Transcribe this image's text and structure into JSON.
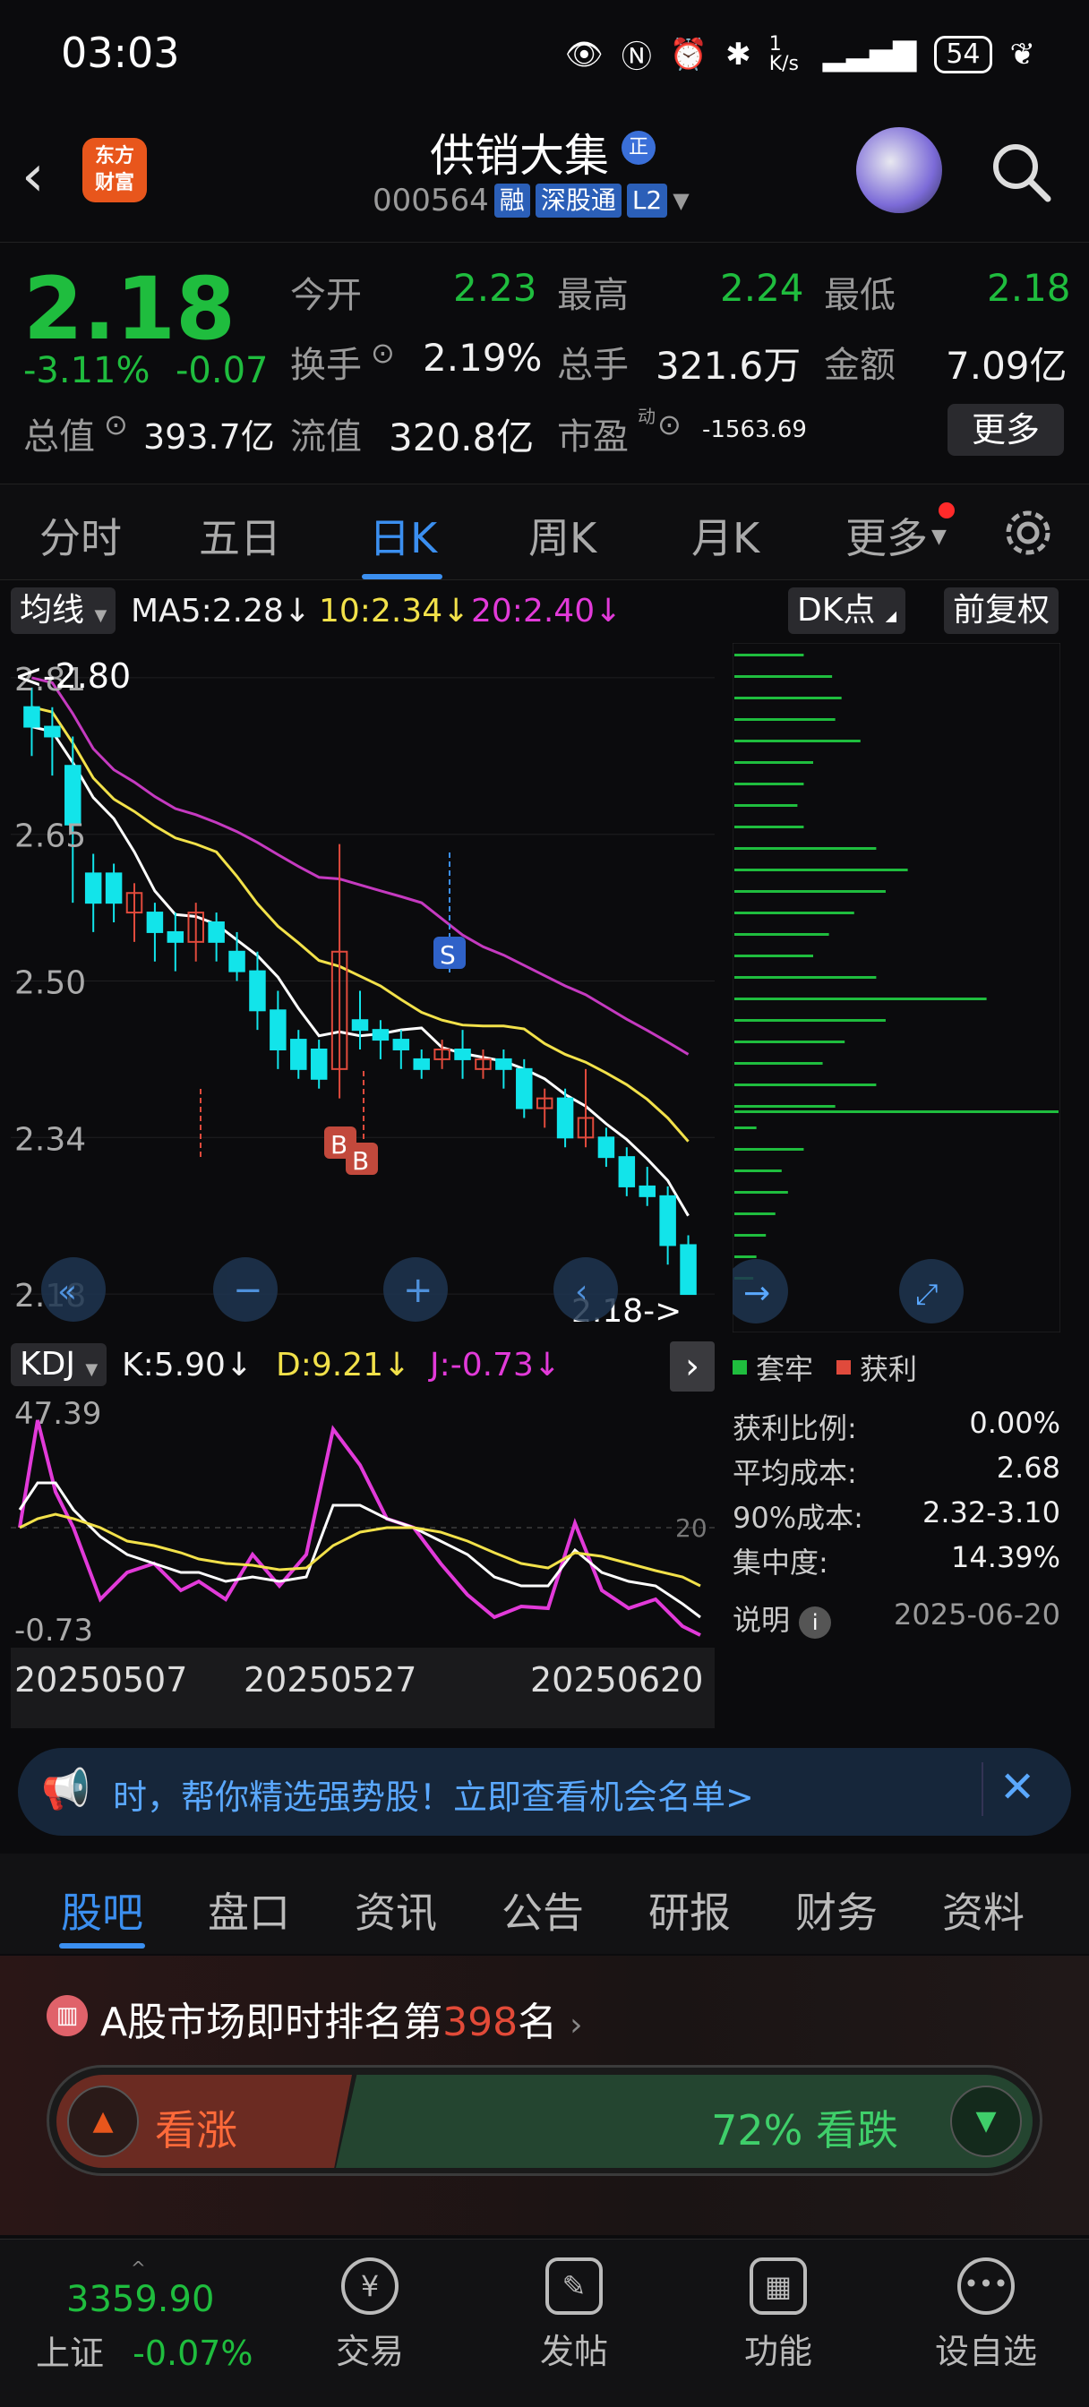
{
  "status_bar": {
    "time": "03:03",
    "speed": "1 K/s",
    "battery": "54"
  },
  "header": {
    "logo_line1": "东方",
    "logo_line2": "财富",
    "stock_name": "供销大集",
    "name_badge": "正",
    "code": "000564",
    "tags": [
      "融",
      "深股通",
      "L2"
    ]
  },
  "quote": {
    "price": "2.18",
    "change_pct": "-3.11%",
    "change": "-0.07",
    "open_label": "今开",
    "open": "2.23",
    "high_label": "最高",
    "high": "2.24",
    "low_label": "最低",
    "low": "2.18",
    "turnover_label": "换手",
    "turnover": "2.19%",
    "volume_label": "总手",
    "volume": "321.6万",
    "amount_label": "金额",
    "amount": "7.09亿",
    "mktcap_label": "总值",
    "mktcap": "393.7亿",
    "float_label": "流值",
    "float": "320.8亿",
    "pe_label": "市盈",
    "pe_sup": "动",
    "pe": "-1563.69",
    "more": "更多"
  },
  "tabs": [
    "分时",
    "五日",
    "日K",
    "周K",
    "月K",
    "更多"
  ],
  "ma_bar": {
    "selector": "均线",
    "ma5": "MA5:2.28↓",
    "ma10": "10:2.34↓",
    "ma20": "20:2.40↓",
    "dk": "DK点",
    "adjust": "前复权"
  },
  "chart_data": {
    "type": "candlestick",
    "y_ticks": [
      "2.81",
      "2.65",
      "2.50",
      "2.34",
      "2.18"
    ],
    "max_label": "<-2.80",
    "last_label": "2.18->",
    "markers": [
      "B",
      "B",
      "S"
    ],
    "candles": [
      [
        2.78,
        2.76,
        2.8,
        2.73
      ],
      [
        2.76,
        2.75,
        2.78,
        2.71
      ],
      [
        2.72,
        2.66,
        2.75,
        2.58
      ],
      [
        2.61,
        2.58,
        2.63,
        2.55
      ],
      [
        2.61,
        2.58,
        2.62,
        2.56
      ],
      [
        2.57,
        2.59,
        2.6,
        2.54
      ],
      [
        2.57,
        2.55,
        2.58,
        2.52
      ],
      [
        2.55,
        2.54,
        2.57,
        2.51
      ],
      [
        2.54,
        2.57,
        2.58,
        2.52
      ],
      [
        2.56,
        2.54,
        2.57,
        2.52
      ],
      [
        2.53,
        2.51,
        2.55,
        2.5
      ],
      [
        2.51,
        2.47,
        2.53,
        2.45
      ],
      [
        2.47,
        2.43,
        2.49,
        2.41
      ],
      [
        2.44,
        2.41,
        2.45,
        2.4
      ],
      [
        2.43,
        2.4,
        2.44,
        2.39
      ],
      [
        2.41,
        2.53,
        2.64,
        2.38
      ],
      [
        2.46,
        2.45,
        2.49,
        2.43
      ],
      [
        2.45,
        2.44,
        2.46,
        2.42
      ],
      [
        2.44,
        2.43,
        2.45,
        2.41
      ],
      [
        2.42,
        2.41,
        2.43,
        2.4
      ],
      [
        2.42,
        2.43,
        2.44,
        2.41
      ],
      [
        2.43,
        2.42,
        2.45,
        2.4
      ],
      [
        2.41,
        2.42,
        2.43,
        2.4
      ],
      [
        2.42,
        2.41,
        2.43,
        2.39
      ],
      [
        2.41,
        2.37,
        2.42,
        2.36
      ],
      [
        2.37,
        2.38,
        2.39,
        2.35
      ],
      [
        2.38,
        2.34,
        2.39,
        2.33
      ],
      [
        2.34,
        2.36,
        2.41,
        2.33
      ],
      [
        2.34,
        2.32,
        2.35,
        2.31
      ],
      [
        2.32,
        2.29,
        2.33,
        2.28
      ],
      [
        2.29,
        2.28,
        2.31,
        2.27
      ],
      [
        2.28,
        2.23,
        2.29,
        2.21
      ],
      [
        2.23,
        2.18,
        2.24,
        2.18
      ]
    ],
    "chip_bars": [
      0.22,
      0.31,
      0.34,
      0.32,
      0.4,
      0.25,
      0.22,
      0.2,
      0.22,
      0.45,
      0.55,
      0.48,
      0.38,
      0.3,
      0.25,
      0.45,
      0.8,
      0.48,
      0.35,
      0.28,
      0.45,
      0.32,
      0.07,
      0.22,
      0.15,
      0.17,
      0.13,
      0.1,
      0.07,
      0.06
    ],
    "chip_peak_index": 20
  },
  "kdj": {
    "selector": "KDJ",
    "k": "K:5.90↓",
    "d": "D:9.21↓",
    "j": "J:-0.73↓",
    "y_top": "47.39",
    "y_bottom": "-0.73",
    "mid_label": "20"
  },
  "dates": [
    "20250507",
    "20250527",
    "20250620"
  ],
  "chip_stats": {
    "legend_hold": "套牢",
    "legend_profit": "获利",
    "rows": [
      {
        "label": "获利比例:",
        "value": "0.00%"
      },
      {
        "label": "平均成本:",
        "value": "2.68"
      },
      {
        "label": "90%成本:",
        "value": "2.32-3.10"
      },
      {
        "label": "集中度:",
        "value": "14.39%"
      }
    ],
    "note": "说明",
    "date": "2025-06-20"
  },
  "banner": {
    "text": "时，帮你精选强势股！立即查看机会名单>"
  },
  "bottom_tabs": [
    "股吧",
    "盘口",
    "资讯",
    "公告",
    "研报",
    "财务",
    "资料"
  ],
  "rank": {
    "prefix": "A股市场即时排名第",
    "rank": "398",
    "suffix": "名",
    "up_label": "看涨",
    "down_label": "72% 看跌"
  },
  "footer": {
    "index_value": "3359.90",
    "index_name": "上证",
    "index_change": "-0.07%",
    "items": [
      "交易",
      "发帖",
      "功能",
      "设自选"
    ]
  },
  "colors": {
    "up": "#e04a3c",
    "down": "#1fbd3e",
    "cyan": "#12e4ea",
    "accent": "#3b8ff0"
  }
}
